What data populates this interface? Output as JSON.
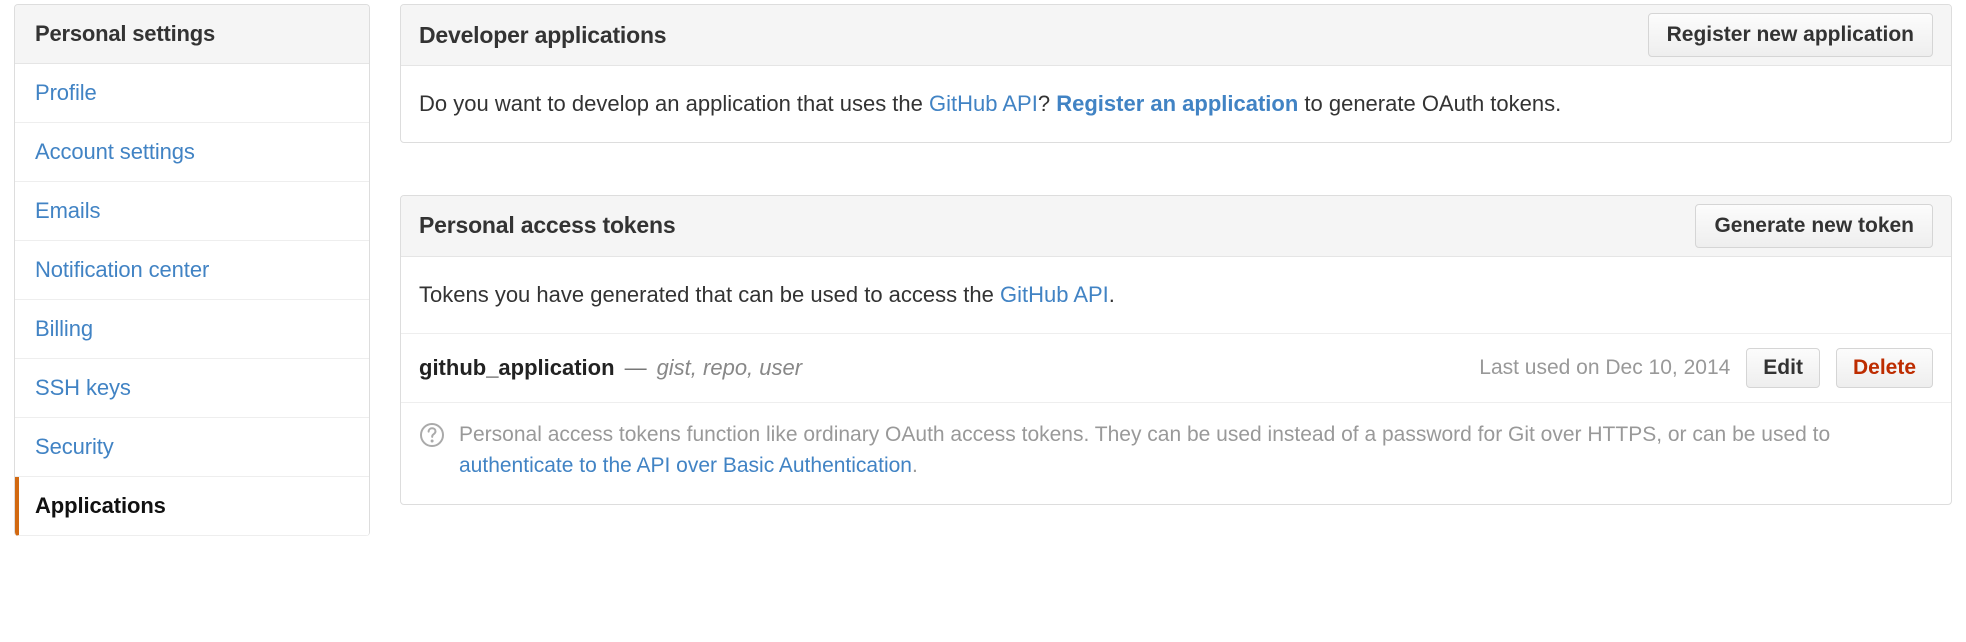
{
  "sidebar": {
    "header": "Personal settings",
    "items": [
      {
        "label": "Profile",
        "selected": false
      },
      {
        "label": "Account settings",
        "selected": false
      },
      {
        "label": "Emails",
        "selected": false
      },
      {
        "label": "Notification center",
        "selected": false
      },
      {
        "label": "Billing",
        "selected": false
      },
      {
        "label": "SSH keys",
        "selected": false
      },
      {
        "label": "Security",
        "selected": false
      },
      {
        "label": "Applications",
        "selected": true
      }
    ]
  },
  "developer_applications": {
    "title": "Developer applications",
    "register_button": "Register new application",
    "description": {
      "part1": "Do you want to develop an application that uses the ",
      "link_api": "GitHub API",
      "part2": "? ",
      "link_register": "Register an application",
      "part3": " to generate OAuth tokens."
    }
  },
  "personal_access_tokens": {
    "title": "Personal access tokens",
    "generate_button": "Generate new token",
    "description": {
      "part1": "Tokens you have generated that can be used to access the ",
      "link_api": "GitHub API",
      "part2": "."
    },
    "tokens": [
      {
        "name": "github_application",
        "separator": "—",
        "scopes": "gist, repo, user",
        "last_used": "Last used on Dec 10, 2014",
        "edit_label": "Edit",
        "delete_label": "Delete"
      }
    ],
    "note": {
      "icon": "question-circle-icon",
      "part1": "Personal access tokens function like ordinary OAuth access tokens. They can be used instead of a password for Git over HTTPS, or can be used to ",
      "link": "authenticate to the API over Basic Authentication",
      "part2": "."
    }
  },
  "colors": {
    "link": "#4183c4",
    "danger": "#bd2c00",
    "accent": "#d26911",
    "muted": "#999999"
  }
}
